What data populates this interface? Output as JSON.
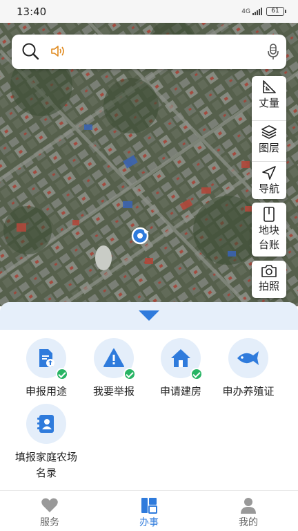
{
  "status_bar": {
    "time": "13:40",
    "network": "4G",
    "battery": "61"
  },
  "search": {
    "placeholder": ""
  },
  "map_tools": [
    {
      "label": "丈量",
      "icon": "ruler-icon"
    },
    {
      "label": "图层",
      "icon": "layers-icon"
    },
    {
      "label": "导航",
      "icon": "navigation-icon"
    }
  ],
  "parcel_ledger": {
    "line1": "地块",
    "line2": "台账",
    "icon": "book-icon"
  },
  "photo": {
    "label": "拍照",
    "icon": "camera-icon"
  },
  "services": [
    {
      "label": "申报用途",
      "icon": "document-upload-icon",
      "checked": true
    },
    {
      "label": "我要举报",
      "icon": "warning-icon",
      "checked": true
    },
    {
      "label": "申请建房",
      "icon": "house-icon",
      "checked": true
    },
    {
      "label": "申办养殖证",
      "icon": "fish-icon",
      "checked": false
    },
    {
      "label_line1": "填报家庭农场",
      "label_line2": "名录",
      "icon": "contact-book-icon",
      "checked": false
    }
  ],
  "tabs": [
    {
      "label": "服务",
      "icon": "heart-icon",
      "active": false
    },
    {
      "label": "办事",
      "icon": "office-icon",
      "active": true
    },
    {
      "label": "我的",
      "icon": "person-icon",
      "active": false
    }
  ],
  "colors": {
    "accent": "#2f7bdc",
    "check": "#28b464",
    "icon_bg": "#e4eefa",
    "speaker": "#e08a1e"
  }
}
